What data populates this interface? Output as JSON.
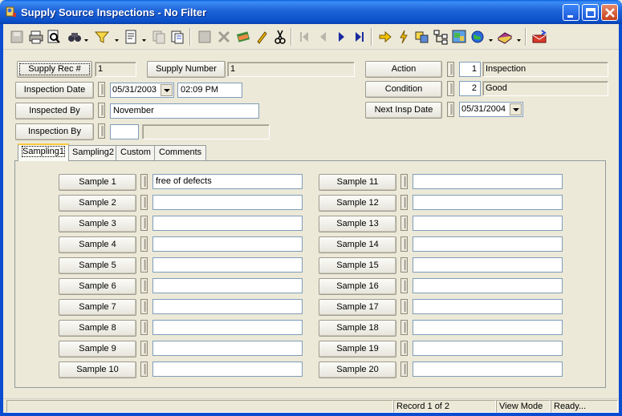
{
  "window": {
    "title": "Supply Source Inspections - No Filter"
  },
  "toolbar": {
    "icons": [
      "save-icon",
      "print-icon",
      "print-preview-icon",
      "find-icon",
      "filter-icon",
      "report-icon",
      "copy-record-icon",
      "paste-record-icon",
      "delete-record-icon",
      "cancel-icon",
      "spellcheck-icon",
      "edit-icon",
      "cut-icon",
      "first-record-icon",
      "previous-record-icon",
      "next-record-icon",
      "last-record-icon",
      "go-to-icon",
      "quick-icon",
      "attach-icon",
      "tree-icon",
      "map-icon",
      "web-icon",
      "books-icon",
      "mail-icon"
    ]
  },
  "header": {
    "supply_rec_label": "Supply Rec #",
    "supply_rec_value": "1",
    "supply_number_label": "Supply Number",
    "supply_number_value": "1",
    "inspection_date_label": "Inspection Date",
    "inspection_date_value": "05/31/2003",
    "inspection_time_value": "02:09 PM",
    "inspected_by_label": "Inspected By",
    "inspected_by_value": "November",
    "inspection_by_label": "Inspection By",
    "inspection_by_code": "",
    "inspection_by_desc": "",
    "action_label": "Action",
    "action_code": "1",
    "action_desc": "Inspection",
    "condition_label": "Condition",
    "condition_code": "2",
    "condition_desc": "Good",
    "next_insp_label": "Next Insp Date",
    "next_insp_value": "05/31/2004"
  },
  "tabs": [
    {
      "label": "Sampling1"
    },
    {
      "label": "Sampling2"
    },
    {
      "label": "Custom"
    },
    {
      "label": "Comments"
    }
  ],
  "samples_left": [
    {
      "label": "Sample 1",
      "value": "free of defects"
    },
    {
      "label": "Sample 2",
      "value": ""
    },
    {
      "label": "Sample 3",
      "value": ""
    },
    {
      "label": "Sample 4",
      "value": ""
    },
    {
      "label": "Sample 5",
      "value": ""
    },
    {
      "label": "Sample 6",
      "value": ""
    },
    {
      "label": "Sample 7",
      "value": ""
    },
    {
      "label": "Sample 8",
      "value": ""
    },
    {
      "label": "Sample 9",
      "value": ""
    },
    {
      "label": "Sample 10",
      "value": ""
    }
  ],
  "samples_right": [
    {
      "label": "Sample 11",
      "value": ""
    },
    {
      "label": "Sample 12",
      "value": ""
    },
    {
      "label": "Sample 13",
      "value": ""
    },
    {
      "label": "Sample 14",
      "value": ""
    },
    {
      "label": "Sample 15",
      "value": ""
    },
    {
      "label": "Sample 16",
      "value": ""
    },
    {
      "label": "Sample 17",
      "value": ""
    },
    {
      "label": "Sample 18",
      "value": ""
    },
    {
      "label": "Sample 19",
      "value": ""
    },
    {
      "label": "Sample 20",
      "value": ""
    }
  ],
  "status": {
    "record": "Record 1 of 2",
    "mode": "View Mode",
    "state": "Ready..."
  },
  "colors": {
    "title_bar": "#0a4fc8",
    "window_bg": "#ece9d8",
    "field_border": "#7f9db9",
    "active_tab_accent": "#ffc83c"
  }
}
